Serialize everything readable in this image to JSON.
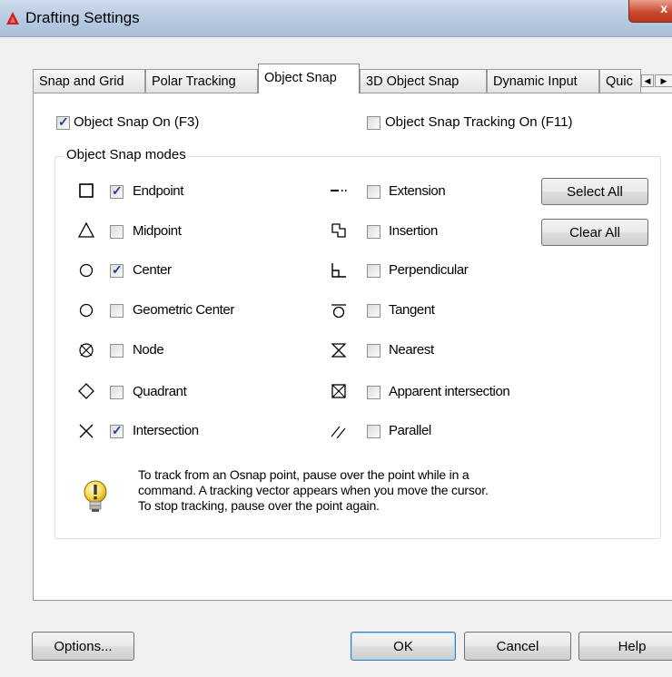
{
  "window": {
    "title": "Drafting Settings",
    "close_glyph": "x"
  },
  "tabs": [
    {
      "label": "Snap and Grid"
    },
    {
      "label": "Polar Tracking"
    },
    {
      "label": "Object Snap",
      "active": true
    },
    {
      "label": "3D Object Snap"
    },
    {
      "label": "Dynamic Input"
    },
    {
      "label": "Quic"
    }
  ],
  "top_options": {
    "snap_on": {
      "label": "Object Snap On (F3)",
      "checked": true
    },
    "tracking_on": {
      "label": "Object Snap Tracking On (F11)",
      "checked": false
    }
  },
  "modes_group": {
    "title": "Object Snap modes",
    "left": [
      {
        "label": "Endpoint",
        "checked": true,
        "icon": "endpoint-icon"
      },
      {
        "label": "Midpoint",
        "checked": false,
        "icon": "midpoint-icon"
      },
      {
        "label": "Center",
        "checked": true,
        "icon": "center-icon"
      },
      {
        "label": "Geometric Center",
        "checked": false,
        "icon": "geometric-center-icon"
      },
      {
        "label": "Node",
        "checked": false,
        "icon": "node-icon"
      },
      {
        "label": "Quadrant",
        "checked": false,
        "icon": "quadrant-icon"
      },
      {
        "label": "Intersection",
        "checked": true,
        "icon": "intersection-icon"
      }
    ],
    "right": [
      {
        "label": "Extension",
        "checked": false,
        "icon": "extension-icon"
      },
      {
        "label": "Insertion",
        "checked": false,
        "icon": "insertion-icon"
      },
      {
        "label": "Perpendicular",
        "checked": false,
        "icon": "perpendicular-icon"
      },
      {
        "label": "Tangent",
        "checked": false,
        "icon": "tangent-icon"
      },
      {
        "label": "Nearest",
        "checked": false,
        "icon": "nearest-icon"
      },
      {
        "label": "Apparent intersection",
        "checked": false,
        "icon": "apparent-intersection-icon"
      },
      {
        "label": "Parallel",
        "checked": false,
        "icon": "parallel-icon"
      }
    ],
    "select_all_label": "Select All",
    "clear_all_label": "Clear All"
  },
  "info": {
    "icon": "lightbulb-icon",
    "lines": [
      "To track from an Osnap point, pause over the point while in a",
      "command.  A tracking vector appears when you move the cursor.",
      "To stop tracking, pause over the point again."
    ]
  },
  "footer": {
    "options_label": "Options...",
    "ok_label": "OK",
    "cancel_label": "Cancel",
    "help_label": "Help"
  },
  "colors": {
    "accent": "#3c7fb1",
    "check_mark": "#1e3f8a",
    "close_button": "#c8452b",
    "app_icon": "#d42020"
  }
}
